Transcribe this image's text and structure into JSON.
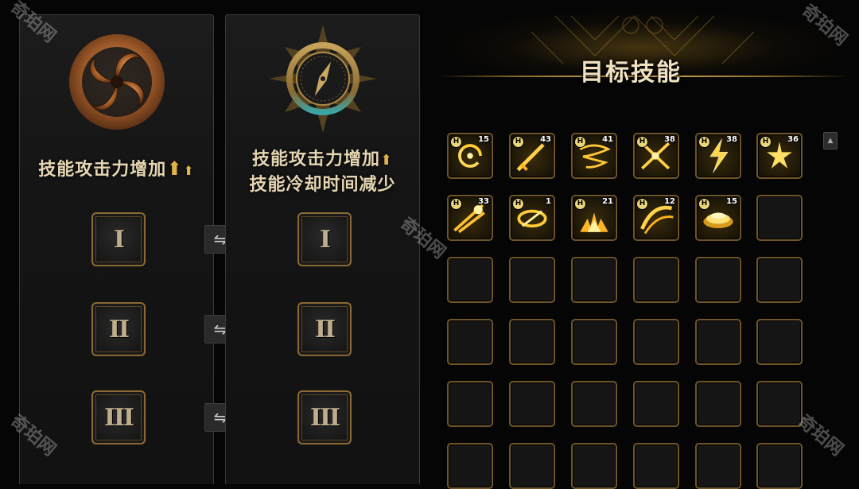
{
  "left_panel": {
    "title_line1": "技能攻击力增加",
    "icon": "fire-spiral-emblem-icon",
    "slots": [
      "I",
      "II",
      "III"
    ]
  },
  "right_panel": {
    "title_line1": "技能攻击力增加",
    "title_line2": "技能冷却时间减少",
    "icon": "compass-emblem-icon",
    "slots": [
      "I",
      "II",
      "III"
    ]
  },
  "swap_buttons": [
    "⇋",
    "⇋",
    "⇋"
  ],
  "up_arrow": "⬆",
  "target_skills": {
    "title": "目标技能",
    "badge": "H",
    "skills": [
      {
        "icon": "vortex-skill-icon",
        "level": "15"
      },
      {
        "icon": "sword-strike-skill-icon",
        "level": "43"
      },
      {
        "icon": "whirlwind-skill-icon",
        "level": "41"
      },
      {
        "icon": "cross-slash-skill-icon",
        "level": "38"
      },
      {
        "icon": "lightning-skill-icon",
        "level": "38"
      },
      {
        "icon": "star-burst-skill-icon",
        "level": "36"
      },
      {
        "icon": "blade-rush-skill-icon",
        "level": "33"
      },
      {
        "icon": "spin-slash-skill-icon",
        "level": "1"
      },
      {
        "icon": "ground-flame-skill-icon",
        "level": "21"
      },
      {
        "icon": "arc-slash-skill-icon",
        "level": "12"
      },
      {
        "icon": "golden-wave-skill-icon",
        "level": "15"
      }
    ],
    "scroll_up": "▲"
  },
  "watermark": "奇珀网",
  "colors": {
    "gold": "#d7b060",
    "frame": "#6f5528",
    "text": "#e6d7b3"
  }
}
